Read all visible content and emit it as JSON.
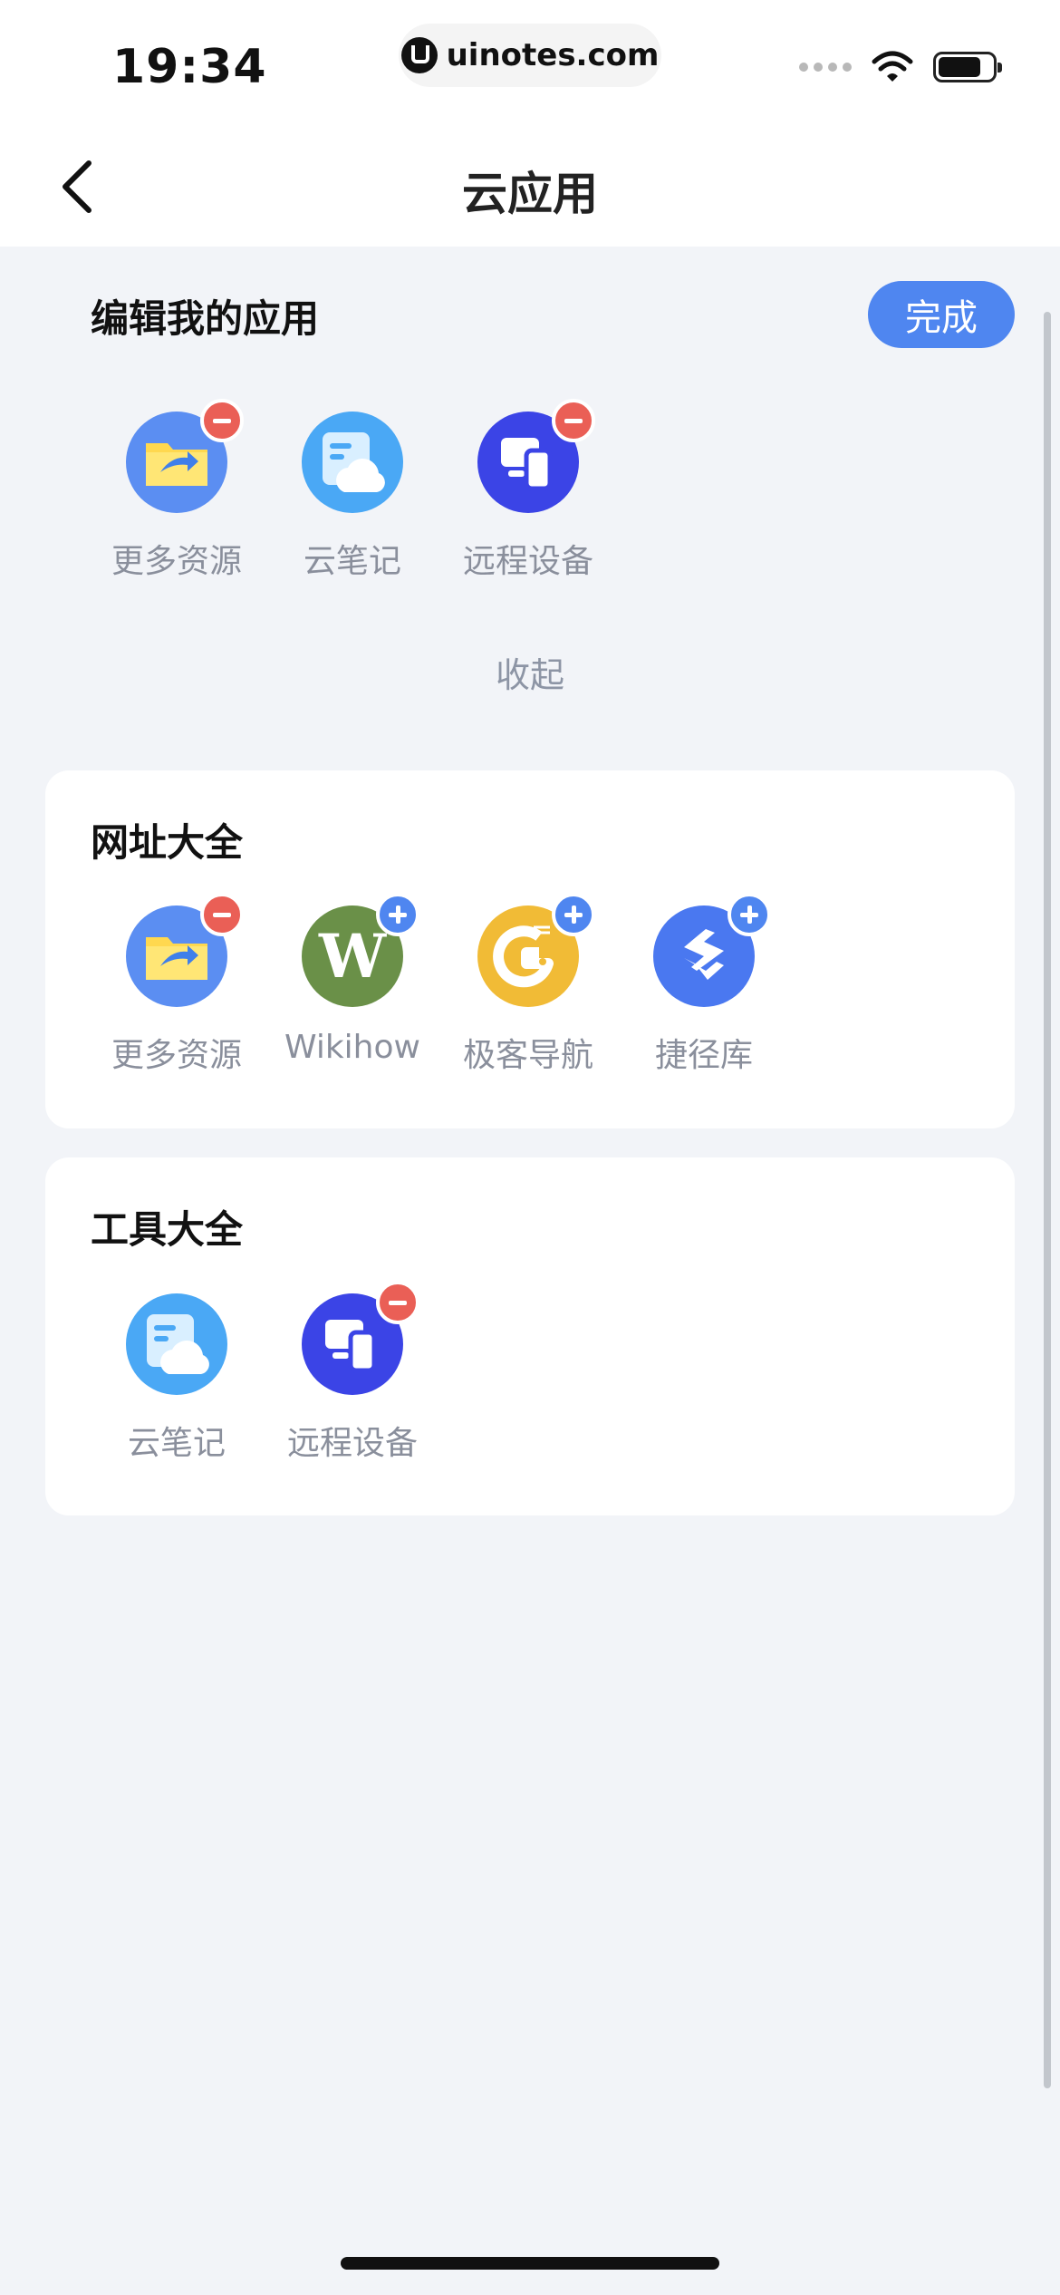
{
  "status_bar": {
    "time": "19:34",
    "url": "uinotes.com"
  },
  "nav": {
    "title": "云应用"
  },
  "my_apps": {
    "title": "编辑我的应用",
    "done_label": "完成",
    "collapse_label": "收起",
    "apps": [
      {
        "label": "更多资源",
        "icon": "folder-share-icon",
        "badge": "remove"
      },
      {
        "label": "云笔记",
        "icon": "cloud-note-icon",
        "badge": "none"
      },
      {
        "label": "远程设备",
        "icon": "remote-devices-icon",
        "badge": "remove"
      }
    ]
  },
  "url_section": {
    "title": "网址大全",
    "apps": [
      {
        "label": "更多资源",
        "icon": "folder-share-icon",
        "badge": "remove"
      },
      {
        "label": "Wikihow",
        "icon": "wikihow-icon",
        "badge": "add",
        "glyph": "W"
      },
      {
        "label": "极客导航",
        "icon": "geek-nav-icon",
        "badge": "add",
        "glyph": "G"
      },
      {
        "label": "捷径库",
        "icon": "shortcuts-icon",
        "badge": "add",
        "glyph": "S"
      }
    ]
  },
  "tools_section": {
    "title": "工具大全",
    "apps": [
      {
        "label": "云笔记",
        "icon": "cloud-note-icon",
        "badge": "none"
      },
      {
        "label": "远程设备",
        "icon": "remote-devices-icon",
        "badge": "remove"
      }
    ]
  },
  "colors": {
    "accent": "#4f86f0",
    "remove_badge": "#ea5f56",
    "folder_bg": "#5b8ef2",
    "cloud_bg": "#4aa8f5",
    "remote_bg": "#3b44e6",
    "wikihow_bg": "#6a9048",
    "geek_bg": "#f1bb36",
    "shortcut_bg": "#4a78f0"
  }
}
